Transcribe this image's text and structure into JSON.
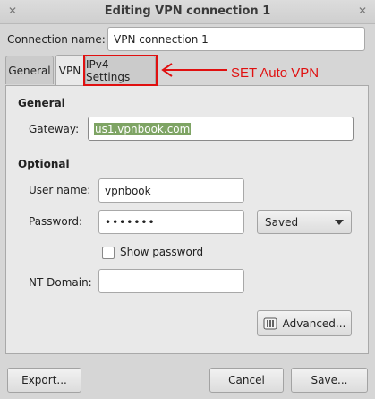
{
  "window": {
    "title": "Editing VPN connection 1",
    "left_btn_glyph": "✕",
    "right_btn_glyph": "✕"
  },
  "connection": {
    "label": "Connection name:",
    "value": "VPN connection 1"
  },
  "tabs": [
    {
      "label": "General",
      "active": false
    },
    {
      "label": "VPN",
      "active": true
    },
    {
      "label": "IPv4 Settings",
      "active": false
    }
  ],
  "annotation": {
    "text": "SET Auto VPN",
    "color": "#e01010"
  },
  "vpn": {
    "general_heading": "General",
    "gateway_label": "Gateway:",
    "gateway_value": "us1.vpnbook.com",
    "optional_heading": "Optional",
    "username_label": "User name:",
    "username_value": "vpnbook",
    "password_label": "Password:",
    "password_value": "•••••••",
    "password_storage": "Saved",
    "show_password_label": "Show password",
    "show_password_checked": false,
    "nt_domain_label": "NT Domain:",
    "nt_domain_value": "",
    "advanced_label": "Advanced..."
  },
  "footer": {
    "export_label": "Export...",
    "cancel_label": "Cancel",
    "save_label": "Save..."
  }
}
